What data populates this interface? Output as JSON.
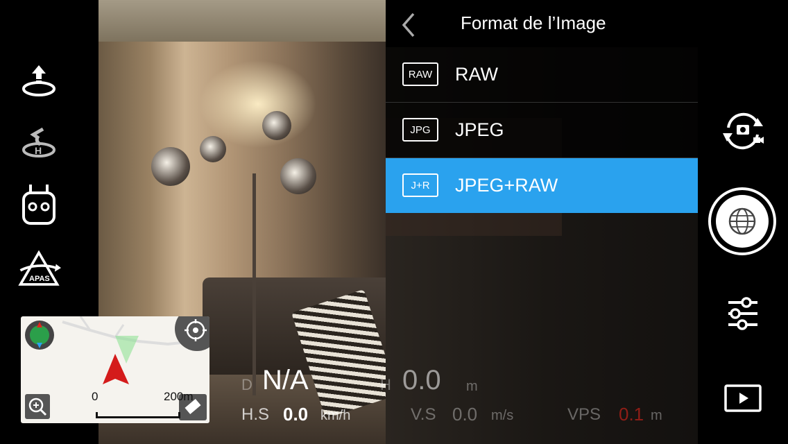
{
  "panel": {
    "title": "Format de l’Image",
    "options": [
      {
        "badge": "RAW",
        "label": "RAW",
        "selected": false
      },
      {
        "badge": "JPG",
        "label": "JPEG",
        "selected": false
      },
      {
        "badge": "J+R",
        "label": "JPEG+RAW",
        "selected": true
      }
    ],
    "accent": "#2aa2ee"
  },
  "left_rail": {
    "icons": [
      "takeoff-icon",
      "return-home-icon",
      "remote-controller-icon",
      "apas-icon"
    ],
    "apas_label": "APAS"
  },
  "map": {
    "scale_start": "0",
    "scale_end": "200m"
  },
  "telemetry": {
    "d_label": "D",
    "d_value": "N/A",
    "h_label": "H",
    "h_value": "0.0",
    "h_unit": "m",
    "hs_label": "H.S",
    "hs_value": "0.0",
    "hs_unit": "km/h",
    "vs_label": "V.S",
    "vs_value": "0.0",
    "vs_unit": "m/s",
    "vps_label": "VPS",
    "vps_value": "0.1",
    "vps_unit": "m",
    "vps_color": "#e0251b"
  },
  "right_rail": {
    "icons": [
      "camera-switch-icon",
      "shutter-button",
      "settings-sliders-icon",
      "playback-icon"
    ]
  }
}
